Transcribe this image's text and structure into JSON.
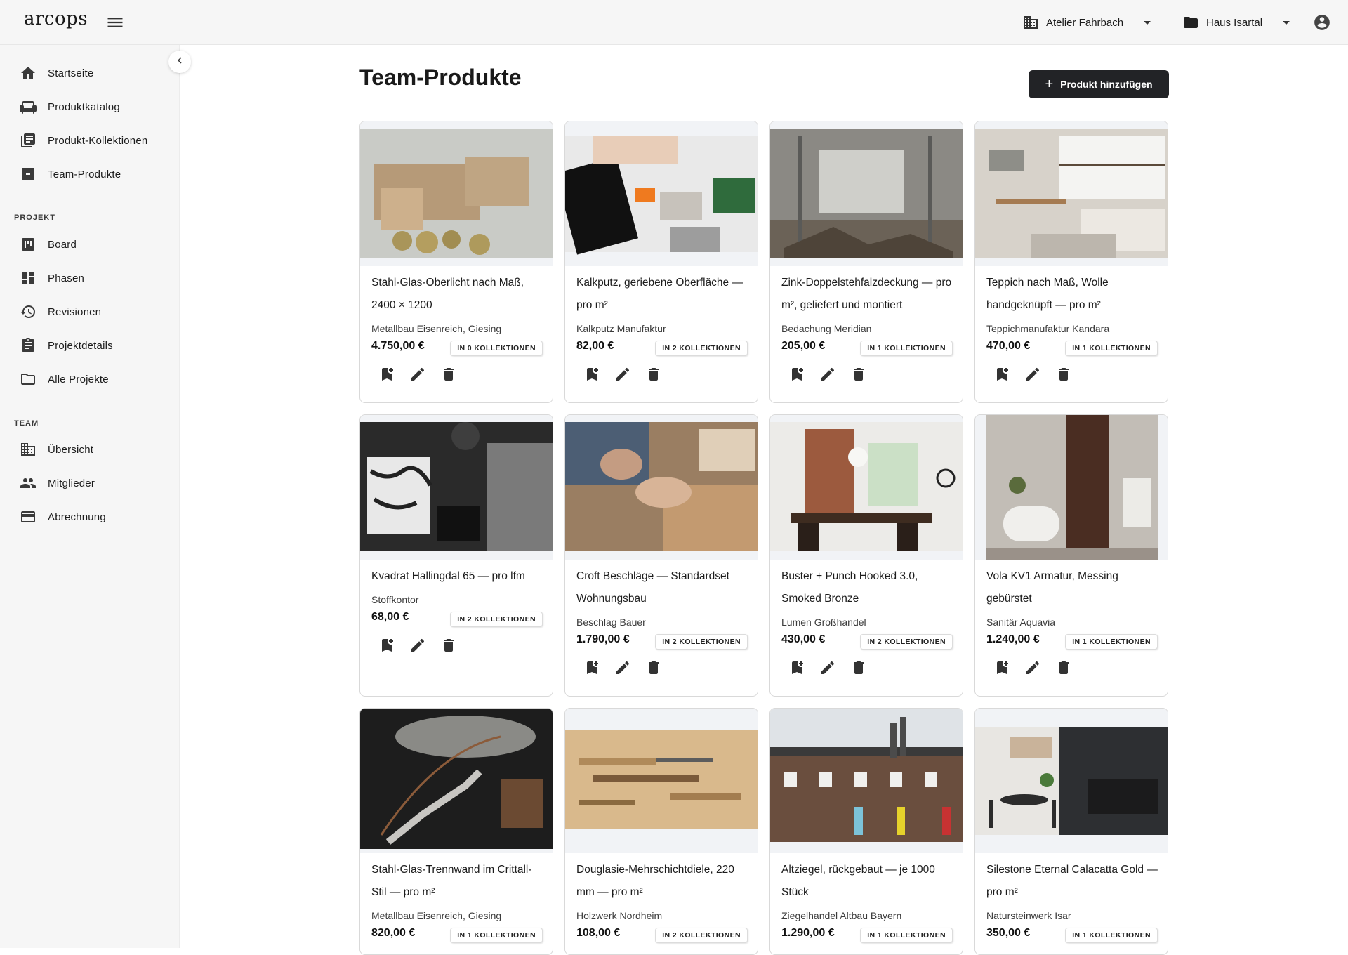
{
  "app": {
    "logo_text": "arcops"
  },
  "header": {
    "organization": "Atelier Fahrbach",
    "project": "Haus Isartal"
  },
  "sidebar": {
    "main_items": [
      {
        "label": "Startseite",
        "icon": "home-icon"
      },
      {
        "label": "Produktkatalog",
        "icon": "sofa-icon"
      },
      {
        "label": "Produkt-Kollektionen",
        "icon": "library-icon"
      },
      {
        "label": "Team-Produkte",
        "icon": "archive-icon"
      }
    ],
    "project_section": "PROJEKT",
    "project_items": [
      {
        "label": "Board",
        "icon": "board-icon"
      },
      {
        "label": "Phasen",
        "icon": "dashboard-icon"
      },
      {
        "label": "Revisionen",
        "icon": "history-icon"
      },
      {
        "label": "Projektdetails",
        "icon": "assignment-icon"
      },
      {
        "label": "Alle Projekte",
        "icon": "folder-outline-icon"
      }
    ],
    "team_section": "TEAM",
    "team_items": [
      {
        "label": "Übersicht",
        "icon": "building-icon"
      },
      {
        "label": "Mitglieder",
        "icon": "people-icon"
      },
      {
        "label": "Abrechnung",
        "icon": "credit-card-icon"
      }
    ]
  },
  "main": {
    "title": "Team-Produkte",
    "add_button": "Produkt hinzufügen",
    "products": [
      {
        "name": "Stahl-Glas-Oberlicht nach Maß, 2400 × 1200",
        "vendor": "Metallbau Eisenreich, Giesing",
        "price": "4.750,00 €",
        "collections": "IN 0 KOLLEKTIONEN"
      },
      {
        "name": "Kalkputz, geriebene Oberfläche — pro m²",
        "vendor": "Kalkputz Manufaktur",
        "price": "82,00 €",
        "collections": "IN 2 KOLLEKTIONEN"
      },
      {
        "name": "Zink-Doppelstehfalzdeckung — pro m², geliefert und montiert",
        "vendor": "Bedachung Meridian",
        "price": "205,00 €",
        "collections": "IN 1 KOLLEKTIONEN"
      },
      {
        "name": "Teppich nach Maß, Wolle handgeknüpft — pro m²",
        "vendor": "Teppichmanufaktur Kandara",
        "price": "470,00 €",
        "collections": "IN 1 KOLLEKTIONEN"
      },
      {
        "name": "Kvadrat Hallingdal 65 — pro lfm",
        "vendor": "Stoffkontor",
        "price": "68,00 €",
        "collections": "IN 2 KOLLEKTIONEN"
      },
      {
        "name": "Croft Beschläge — Standardset Wohnungsbau",
        "vendor": "Beschlag Bauer",
        "price": "1.790,00 €",
        "collections": "IN 2 KOLLEKTIONEN"
      },
      {
        "name": "Buster + Punch Hooked 3.0, Smoked Bronze",
        "vendor": "Lumen Großhandel",
        "price": "430,00 €",
        "collections": "IN 2 KOLLEKTIONEN"
      },
      {
        "name": "Vola KV1 Armatur, Messing gebürstet",
        "vendor": "Sanitär Aquavia",
        "price": "1.240,00 €",
        "collections": "IN 1 KOLLEKTIONEN"
      },
      {
        "name": "Stahl-Glas-Trennwand im Crittall-Stil — pro m²",
        "vendor": "Metallbau Eisenreich, Giesing",
        "price": "820,00 €",
        "collections": "IN 1 KOLLEKTIONEN"
      },
      {
        "name": "Douglasie-Mehrschichtdiele, 220 mm — pro m²",
        "vendor": "Holzwerk Nordheim",
        "price": "108,00 €",
        "collections": "IN 2 KOLLEKTIONEN"
      },
      {
        "name": "Altziegel, rückgebaut — je 1000 Stück",
        "vendor": "Ziegelhandel Altbau Bayern",
        "price": "1.290,00 €",
        "collections": "IN 1 KOLLEKTIONEN"
      },
      {
        "name": "Silestone Eternal Calacatta Gold — pro m²",
        "vendor": "Natursteinwerk Isar",
        "price": "350,00 €",
        "collections": "IN 1 KOLLEKTIONEN"
      }
    ]
  }
}
